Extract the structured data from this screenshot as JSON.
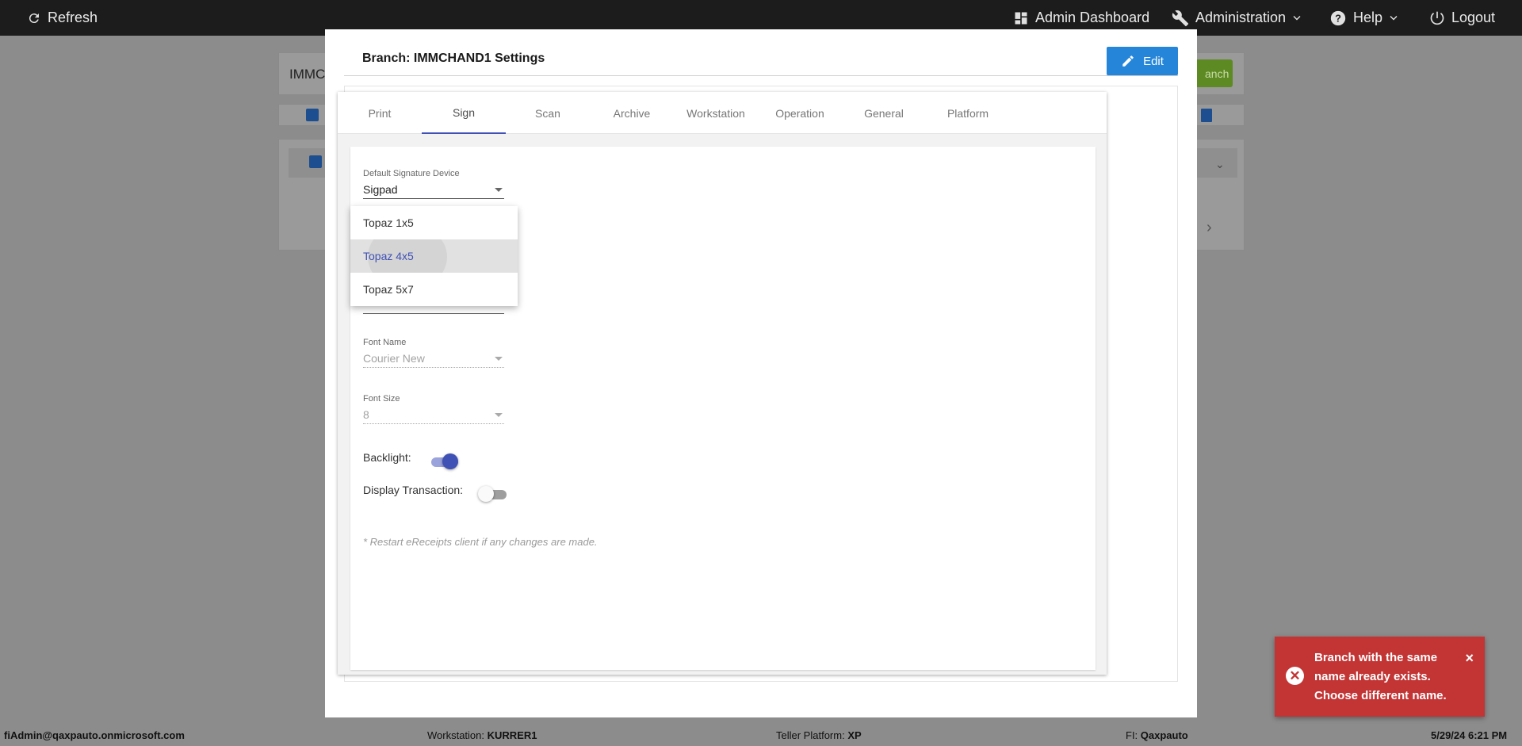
{
  "topbar": {
    "refresh_label": "Refresh",
    "admin_dashboard_label": "Admin Dashboard",
    "administration_label": "Administration",
    "help_label": "Help",
    "logout_label": "Logout"
  },
  "background": {
    "search_value": "IMMC",
    "add_button_label": "anch"
  },
  "modal": {
    "title": "Branch: IMMCHAND1 Settings",
    "edit_label": "Edit",
    "tabs": [
      {
        "label": "Print"
      },
      {
        "label": "Sign"
      },
      {
        "label": "Scan"
      },
      {
        "label": "Archive"
      },
      {
        "label": "Workstation"
      },
      {
        "label": "Operation"
      },
      {
        "label": "General"
      },
      {
        "label": "Platform"
      }
    ],
    "active_tab": "Sign",
    "sign": {
      "default_device_label": "Default Signature Device",
      "default_device_value": "Sigpad",
      "dropdown_options": [
        "Topaz 1x5",
        "Topaz 4x5",
        "Topaz 5x7"
      ],
      "highlighted_option": "Topaz 4x5",
      "font_name_label": "Font Name",
      "font_name_value": "Courier New",
      "font_size_label": "Font Size",
      "font_size_value": "8",
      "backlight_label": "Backlight:",
      "backlight_on": true,
      "display_transaction_label": "Display Transaction:",
      "display_transaction_on": false,
      "note": "* Restart eReceipts client if any changes are made."
    }
  },
  "toast": {
    "message": "Branch with the same name already exists. Choose different name.",
    "close": "×",
    "icon": "error-circle-icon"
  },
  "statusbar": {
    "user": "fiAdmin@qaxpauto.onmicrosoft.com",
    "workstation_label": "Workstation:",
    "workstation_value": "KURRER1",
    "platform_label": "Teller Platform:",
    "platform_value": "XP",
    "fi_label": "FI:",
    "fi_value": "Qaxpauto",
    "datetime": "5/29/24 6:21 PM"
  },
  "colors": {
    "primary": "#3f51b5",
    "edit_button": "#2585d9",
    "toast": "#c33535",
    "topbar": "#1c1c1c"
  }
}
